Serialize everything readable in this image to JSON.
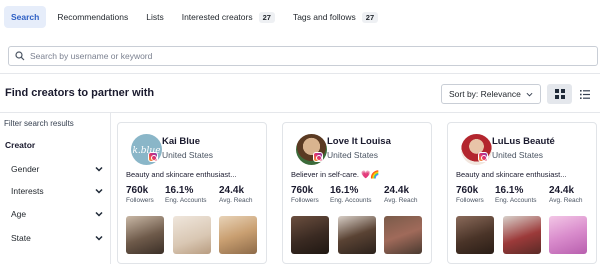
{
  "tabs": [
    {
      "label": "Search",
      "active": true
    },
    {
      "label": "Recommendations"
    },
    {
      "label": "Lists"
    },
    {
      "label": "Interested creators",
      "count": "27"
    },
    {
      "label": "Tags and follows",
      "count": "27"
    }
  ],
  "search": {
    "placeholder": "Search by username or keyword"
  },
  "header": {
    "title": "Find creators to partner with",
    "sort_label": "Sort by: Relevance"
  },
  "sidebar": {
    "heading": "Filter search results",
    "section": "Creator",
    "filters": [
      "Gender",
      "Interests",
      "Age",
      "State"
    ]
  },
  "creators": [
    {
      "name": "Kai Blue",
      "location": "United States",
      "bio": "Beauty and skincare enthusiast...",
      "stats": [
        {
          "value": "760k",
          "label": "Followers"
        },
        {
          "value": "16.1%",
          "label": "Eng. Accounts"
        },
        {
          "value": "24.4k",
          "label": "Avg. Reach"
        }
      ]
    },
    {
      "name": "Love It Louisa",
      "location": "United States",
      "bio": "Believer in self-care. 💗🌈",
      "stats": [
        {
          "value": "760k",
          "label": "Followers"
        },
        {
          "value": "16.1%",
          "label": "Eng. Accounts"
        },
        {
          "value": "24.4k",
          "label": "Avg. Reach"
        }
      ]
    },
    {
      "name": "LuLus Beauté",
      "location": "United States",
      "bio": "Beauty and skincare enthusiast...",
      "stats": [
        {
          "value": "760k",
          "label": "Followers"
        },
        {
          "value": "16.1%",
          "label": "Eng. Accounts"
        },
        {
          "value": "24.4k",
          "label": "Avg. Reach"
        }
      ]
    }
  ],
  "colors": {
    "accent": "#2d5fc4",
    "accent_bg": "#e6edfa",
    "border": "#e1e4e8"
  }
}
